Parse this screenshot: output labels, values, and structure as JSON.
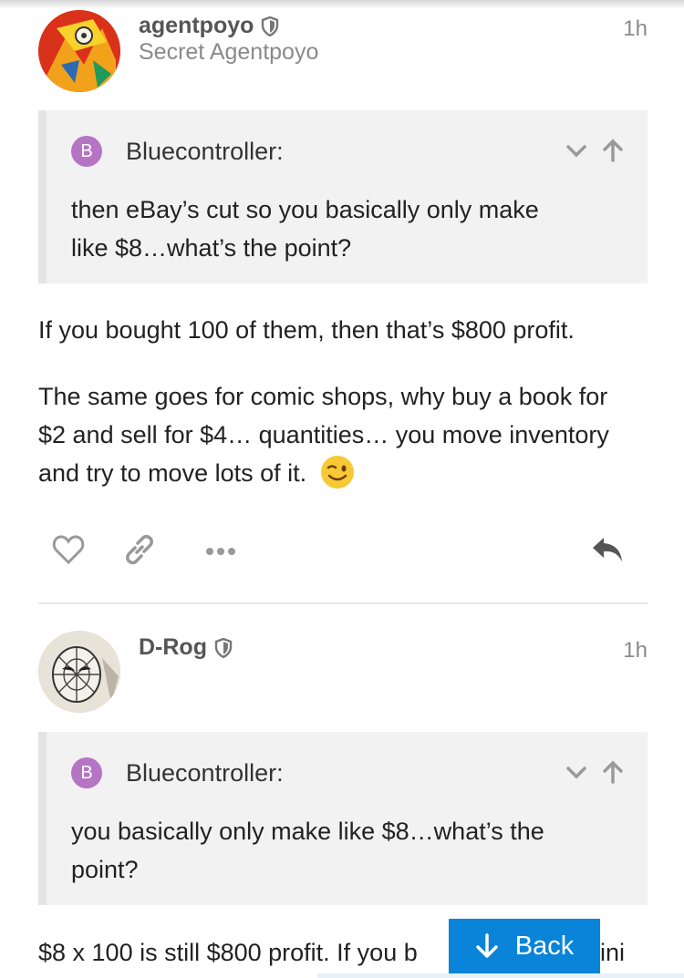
{
  "posts": [
    {
      "username": "agentpoyo",
      "user_title": "Secret Agentpoyo",
      "time": "1h",
      "quote": {
        "badge": "B",
        "user": "Bluecontroller:",
        "lines": [
          "then eBay’s cut so you basically only make",
          "like $8…what’s the point?"
        ]
      },
      "paragraphs": [
        "If you bought 100 of them, then that’s $800 profit.",
        "The same goes for comic shops, why buy a book for $2 and sell for $4… quantities… you move inventory and try to move lots of it."
      ],
      "emoji": "winking-face"
    },
    {
      "username": "D-Rog",
      "time": "1h",
      "quote": {
        "badge": "B",
        "user": "Bluecontroller:",
        "lines": [
          "you basically only make like $8…what’s the",
          "point?"
        ]
      },
      "paragraphs": [
        "$8 x 100 is still $800 profit. If you b",
        "ini"
      ]
    }
  ],
  "back_button": {
    "label": "Back"
  },
  "colors": {
    "accent": "#0a84d8",
    "quote_badge": "#b574c4"
  }
}
